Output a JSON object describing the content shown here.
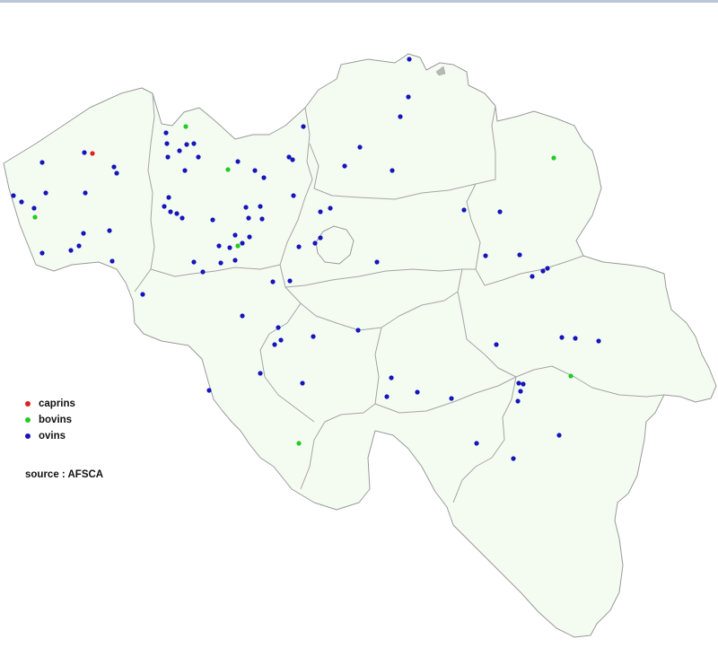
{
  "legend": {
    "items": [
      {
        "label": "caprins",
        "color": "#dd2222"
      },
      {
        "label": "bovins",
        "color": "#22cc22"
      },
      {
        "label": "ovins",
        "color": "#1515bb"
      }
    ]
  },
  "source": "source : AFSCA"
}
